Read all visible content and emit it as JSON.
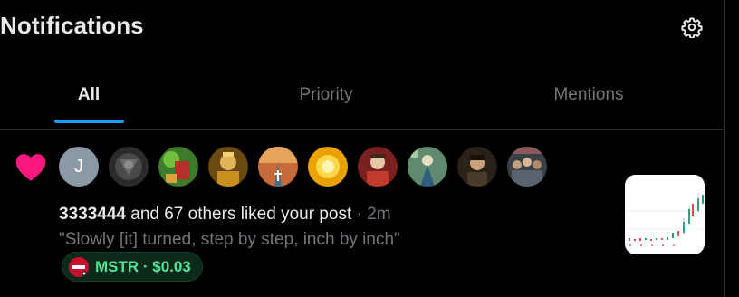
{
  "header": {
    "title": "Notifications",
    "settings_icon": "gear-icon"
  },
  "tabs": [
    {
      "label": "All",
      "active": true
    },
    {
      "label": "Priority",
      "active": false
    },
    {
      "label": "Mentions",
      "active": false
    }
  ],
  "colors": {
    "accent": "#1d9bf0",
    "like": "#f91880",
    "ticker_text": "#4ee49a",
    "muted": "#71767b"
  },
  "notification": {
    "type_icon": "heart-icon",
    "avatars": [
      {
        "kind": "initial",
        "letter": "J"
      },
      {
        "kind": "image",
        "icon": "avatar-gray-emblem"
      },
      {
        "kind": "image",
        "icon": "avatar-green-red"
      },
      {
        "kind": "image",
        "icon": "avatar-portrait-gold"
      },
      {
        "kind": "image",
        "icon": "avatar-road-cross"
      },
      {
        "kind": "image",
        "icon": "avatar-sun"
      },
      {
        "kind": "image",
        "icon": "avatar-portrait-red"
      },
      {
        "kind": "image",
        "icon": "avatar-figure-teal"
      },
      {
        "kind": "image",
        "icon": "avatar-portrait-dark"
      },
      {
        "kind": "image",
        "icon": "avatar-crowd"
      }
    ],
    "user": "3333444",
    "action_text": "and 67 others liked your post",
    "separator": "·",
    "time": "2m",
    "quote": "\"Slowly [it] turned, step by step, inch by inch\"",
    "ticker": {
      "label": "MSTR · $0.03",
      "logo_icon": "mstr-logo-icon"
    },
    "thumbnail_icon": "candlestick-chart-thumbnail"
  }
}
